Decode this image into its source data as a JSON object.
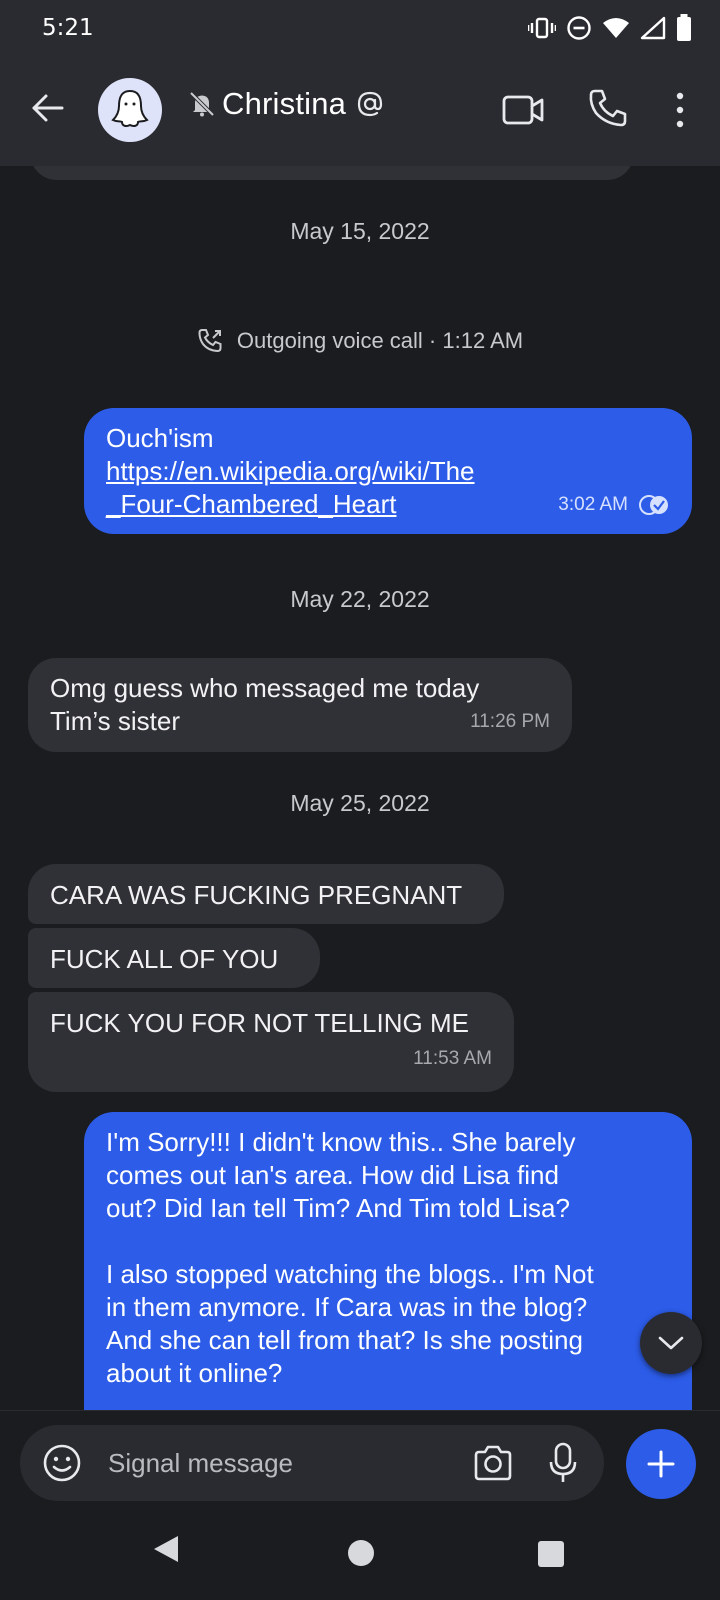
{
  "status_bar": {
    "time": "5:21",
    "icons": [
      "vibrate-icon",
      "do-not-disturb-icon",
      "wifi-icon",
      "cellular-signal-icon",
      "battery-icon"
    ]
  },
  "app_bar": {
    "contact_name": "Christina",
    "icons": [
      "back-arrow-icon",
      "ghost-avatar-icon",
      "muted-bell-icon",
      "mention-icon",
      "video-call-icon",
      "phone-icon",
      "overflow-menu-icon"
    ]
  },
  "conversation": {
    "date_1": "May 15, 2022",
    "call_event": "Outgoing voice call · 1:12 AM",
    "out_1": {
      "line_1": "Ouch'ism",
      "link_1": "https://en.wikipedia.org/wiki/The",
      "link_2": "_Four-Chambered_Heart",
      "time": "3:02 AM"
    },
    "date_2": "May 22, 2022",
    "in_1": {
      "line_1": "Omg guess who messaged me today",
      "line_2": "Tim’s sister",
      "time": "11:26 PM"
    },
    "date_3": "May 25, 2022",
    "in_2": {
      "text": "CARA WAS FUCKING PREGNANT"
    },
    "in_3": {
      "text": "FUCK ALL OF YOU"
    },
    "in_4": {
      "text": "FUCK YOU FOR NOT TELLING ME",
      "time": "11:53 AM"
    },
    "out_2": {
      "line_1": "I'm Sorry!!! I didn't know this.. She barely",
      "line_2": "comes out Ian's area.  How did Lisa find",
      "line_3": "out? Did Ian tell Tim? And Tim told Lisa?",
      "line_4": "I also stopped watching the blogs.. I'm Not",
      "line_5": "in them anymore. If Cara was in the blog?",
      "line_6": "And she can tell from that? Is she posting",
      "line_7": "about it online?"
    }
  },
  "composer": {
    "placeholder": "Signal message"
  },
  "colors": {
    "background": "#1b1c1f",
    "bar": "#2a2b30",
    "incoming_bubble": "#303136",
    "outgoing_bubble": "#2c5ce8"
  }
}
